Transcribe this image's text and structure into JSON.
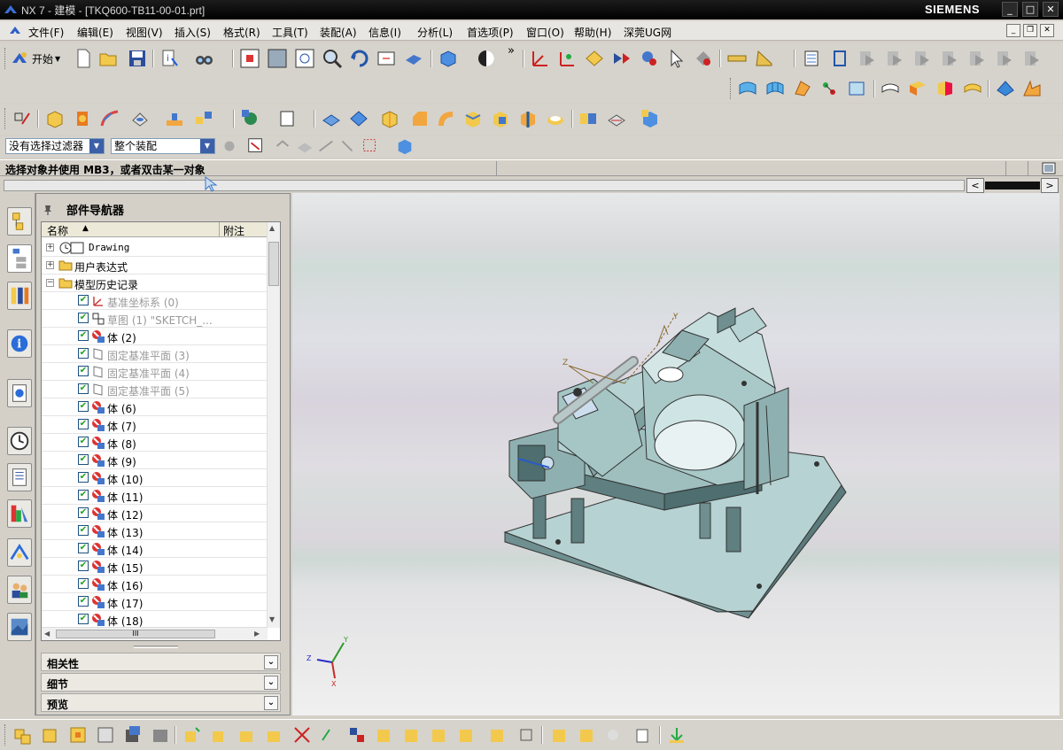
{
  "window": {
    "title": "NX 7 - 建模 - [TKQ600-TB11-00-01.prt]",
    "brand": "SIEMENS",
    "controls": [
      "_",
      "□",
      "✕"
    ]
  },
  "menu": {
    "items": [
      "文件(F)",
      "编辑(E)",
      "视图(V)",
      "插入(S)",
      "格式(R)",
      "工具(T)",
      "装配(A)",
      "信息(I)",
      "分析(L)",
      "首选项(P)",
      "窗口(O)",
      "帮助(H)",
      "深莞UG网"
    ],
    "mdi_controls": [
      "_",
      "❐",
      "✕"
    ]
  },
  "toolbar": {
    "start_label": "开始",
    "overflow": "»"
  },
  "selection_bar": {
    "type_filter": "没有选择过滤器",
    "scope": "整个装配"
  },
  "status": {
    "cue": "选择对象并使用 MB3，或者双击某一对象"
  },
  "navigator": {
    "title": "部件导航器",
    "columns": [
      "名称",
      "附注"
    ],
    "rows": [
      {
        "label": "Drawing",
        "type": "drawing",
        "expand": "+",
        "level": 0,
        "checked": false,
        "dim": false
      },
      {
        "label": "用户表达式",
        "type": "folder",
        "expand": "+",
        "level": 0,
        "checked": false,
        "dim": false
      },
      {
        "label": "模型历史记录",
        "type": "folder",
        "expand": "-",
        "level": 0,
        "checked": false,
        "dim": false
      },
      {
        "label": "基准坐标系 (0)",
        "type": "csys",
        "level": 1,
        "checked": true,
        "dim": true
      },
      {
        "label": "草图 (1) \"SKETCH_...",
        "type": "sketch",
        "level": 1,
        "checked": true,
        "dim": true
      },
      {
        "label": "体 (2)",
        "type": "body",
        "level": 1,
        "checked": true,
        "dim": false
      },
      {
        "label": "固定基准平面 (3)",
        "type": "plane",
        "level": 1,
        "checked": true,
        "dim": true
      },
      {
        "label": "固定基准平面 (4)",
        "type": "plane",
        "level": 1,
        "checked": true,
        "dim": true
      },
      {
        "label": "固定基准平面 (5)",
        "type": "plane",
        "level": 1,
        "checked": true,
        "dim": true
      },
      {
        "label": "体 (6)",
        "type": "body",
        "level": 1,
        "checked": true,
        "dim": false
      },
      {
        "label": "体 (7)",
        "type": "body",
        "level": 1,
        "checked": true,
        "dim": false
      },
      {
        "label": "体 (8)",
        "type": "body",
        "level": 1,
        "checked": true,
        "dim": false
      },
      {
        "label": "体 (9)",
        "type": "body",
        "level": 1,
        "checked": true,
        "dim": false
      },
      {
        "label": "体 (10)",
        "type": "body",
        "level": 1,
        "checked": true,
        "dim": false
      },
      {
        "label": "体 (11)",
        "type": "body",
        "level": 1,
        "checked": true,
        "dim": false
      },
      {
        "label": "体 (12)",
        "type": "body",
        "level": 1,
        "checked": true,
        "dim": false
      },
      {
        "label": "体 (13)",
        "type": "body",
        "level": 1,
        "checked": true,
        "dim": false
      },
      {
        "label": "体 (14)",
        "type": "body",
        "level": 1,
        "checked": true,
        "dim": false
      },
      {
        "label": "体 (15)",
        "type": "body",
        "level": 1,
        "checked": true,
        "dim": false
      },
      {
        "label": "体 (16)",
        "type": "body",
        "level": 1,
        "checked": true,
        "dim": false
      },
      {
        "label": "体 (17)",
        "type": "body",
        "level": 1,
        "checked": true,
        "dim": false
      },
      {
        "label": "体 (18)",
        "type": "body",
        "level": 1,
        "checked": true,
        "dim": false
      }
    ],
    "hscroll_thumb": "III",
    "panels": [
      "相关性",
      "细节",
      "预览"
    ]
  },
  "viewport": {
    "triad_labels": {
      "x": "X",
      "y": "Y",
      "z": "Z"
    },
    "csys_labels": {
      "y": "Y",
      "z": "Z"
    },
    "model_color": "#a9c8c8"
  },
  "colors": {
    "titlebar": "#000000",
    "chrome": "#d4d0c8",
    "tree_check": "#21a121",
    "selection_combo_arrow": "#3c5fa8"
  }
}
